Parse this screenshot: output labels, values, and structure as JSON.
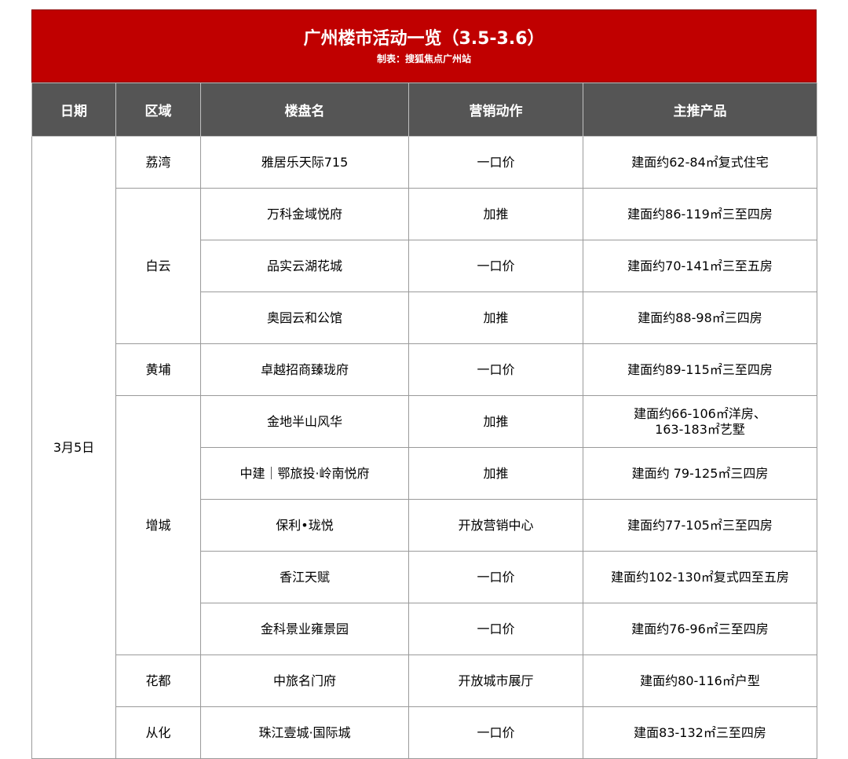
{
  "title": "广州楼市活动一览（3.5-3.6）",
  "subtitle": "制表：搜狐焦点广州站",
  "headers": [
    "日期",
    "区域",
    "楼盘名",
    "营销动作",
    "主推产品"
  ],
  "date": "3月5日",
  "districts": [
    "荔湾",
    "白云",
    "黄埔",
    "增城",
    "花都",
    "从化"
  ],
  "rows": [
    {
      "project": "雅居乐天际715",
      "action": "一口价",
      "product": "建面约62-84㎡复式住宅"
    },
    {
      "project": "万科金域悦府",
      "action": "加推",
      "product": "建面约86-119㎡三至四房"
    },
    {
      "project": "品实云湖花城",
      "action": "一口价",
      "product": "建面约70-141㎡三至五房"
    },
    {
      "project": "奥园云和公馆",
      "action": "加推",
      "product": "建面约88-98㎡三四房"
    },
    {
      "project": "卓越招商臻珑府",
      "action": "一口价",
      "product": "建面约89-115㎡三至四房"
    },
    {
      "project": "金地半山风华",
      "action": "加推",
      "product": "建面约66-106㎡洋房、",
      "product2": "163-183㎡艺墅"
    },
    {
      "project": "中建｜鄂旅投·岭南悦府",
      "action": "加推",
      "product": "建面约 79-125㎡三四房"
    },
    {
      "project": "保利•珑悦",
      "action": "开放营销中心",
      "product": "建面约77-105㎡三至四房"
    },
    {
      "project": "香江天赋",
      "action": "一口价",
      "product": "建面约102-130㎡复式四至五房"
    },
    {
      "project": "金科景业雍景园",
      "action": "一口价",
      "product": "建面约76-96㎡三至四房"
    },
    {
      "project": "中旅名门府",
      "action": "开放城市展厅",
      "product": "建面约80-116㎡户型"
    },
    {
      "project": "珠江壹城·国际城",
      "action": "一口价",
      "product": "建面83-132㎡三至四房"
    }
  ]
}
